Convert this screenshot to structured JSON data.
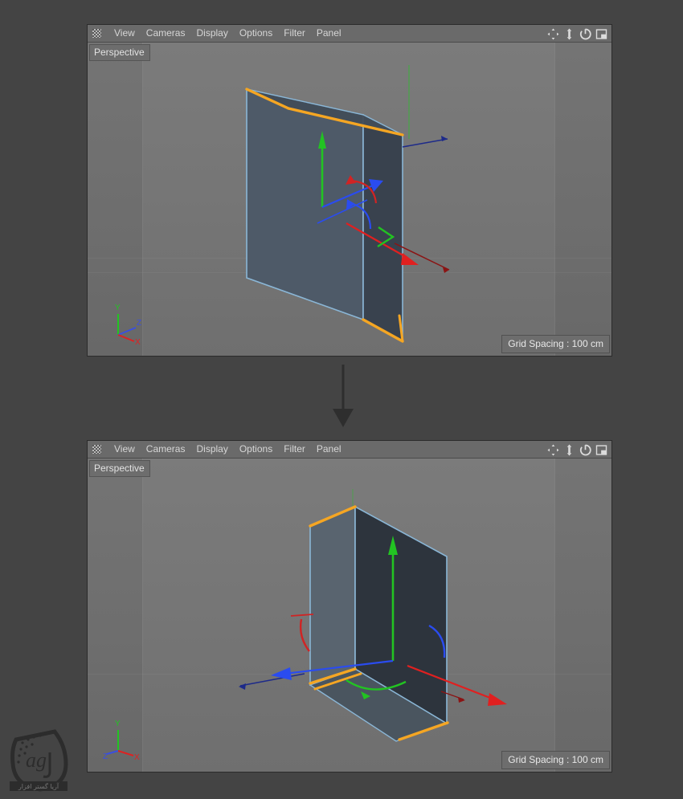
{
  "app": {
    "background_color": "#444444",
    "accent_selection_color": "#f5a623",
    "edge_color": "#8ab6d6"
  },
  "menu": {
    "grip_icon": "grip-dots-icon",
    "items": [
      {
        "label": "View"
      },
      {
        "label": "Cameras"
      },
      {
        "label": "Display"
      },
      {
        "label": "Options"
      },
      {
        "label": "Filter"
      },
      {
        "label": "Panel"
      }
    ],
    "tools": [
      {
        "name": "move-tool-icon",
        "title": "Move"
      },
      {
        "name": "scale-tool-icon",
        "title": "Scale"
      },
      {
        "name": "rotate-tool-icon",
        "title": "Rotate"
      },
      {
        "name": "layout-panel-icon",
        "title": "Panel Layout"
      }
    ]
  },
  "viewports": [
    {
      "id": "viewport-top",
      "view_label": "Perspective",
      "grid_spacing": "Grid Spacing : 100 cm",
      "axis_gizmo": {
        "y_label": "Y",
        "z_label": "Z",
        "x_label": "X",
        "y_color": "#22c322",
        "z_color": "#3a4fe0",
        "x_color": "#dd2222"
      },
      "object": {
        "name": "box-mesh",
        "selected_edges": 4,
        "selection_color": "#f5a623",
        "wire_color": "#8ab6d6",
        "face_light": "#4e5a68",
        "face_dark": "#3a4450"
      },
      "gizmo": {
        "y_axis_color": "#22c322",
        "z_axis_color": "#2a4cf0",
        "x_axis_color": "#e02020"
      }
    },
    {
      "id": "viewport-bottom",
      "view_label": "Perspective",
      "grid_spacing": "Grid Spacing : 100 cm",
      "axis_gizmo": {
        "y_label": "Y",
        "z_label": "Z",
        "x_label": "X",
        "y_color": "#22c322",
        "z_color": "#3a4fe0",
        "x_color": "#dd2222"
      },
      "object": {
        "name": "box-mesh-rotated",
        "selected_edges": 4,
        "selection_color": "#f5a623",
        "wire_color": "#8ab6d6",
        "face_light": "#59646f",
        "face_dark": "#2d343d"
      },
      "gizmo": {
        "y_axis_color": "#22c322",
        "z_axis_color": "#2a4cf0",
        "x_axis_color": "#e02020"
      }
    }
  ],
  "flow": {
    "arrow_name": "down-arrow",
    "direction": "down",
    "color": "#2e2e2e"
  },
  "watermark": {
    "name": "site-logo-watermark",
    "text": "agi",
    "subtitle": "آریا گستر افزار"
  }
}
